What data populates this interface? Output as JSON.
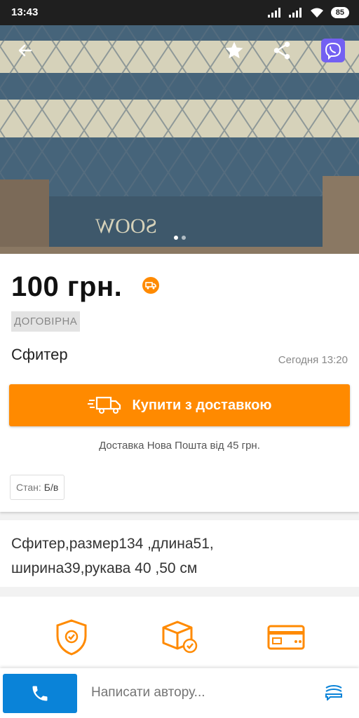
{
  "status_bar": {
    "time": "13:43",
    "battery": "85"
  },
  "toolbar": {
    "icons": [
      "back-arrow-icon",
      "star-icon",
      "share-icon",
      "viber-icon"
    ]
  },
  "gallery": {
    "image_text": "SOOW",
    "dots": 2,
    "active_dot": 0
  },
  "listing": {
    "price": "100 грн.",
    "negotiable": "ДОГОВІРНА",
    "title": "Сфитер",
    "date": "Сегодня 13:20",
    "buy_label": "Купити з доставкою",
    "delivery_note": "Доставка Нова Пошта від 45 грн.",
    "condition_label": "Стан:",
    "condition_value": "Б/в"
  },
  "description": {
    "line1": "Сфитер,размер134 ,длина51,",
    "line2": "ширина39,рукава 40 ,50 см"
  },
  "features": [
    {
      "icon": "shield-check-icon"
    },
    {
      "icon": "box-check-icon"
    },
    {
      "icon": "card-icon"
    }
  ],
  "bottom_bar": {
    "message_placeholder": "Написати автору..."
  },
  "colors": {
    "accent": "#ff8a00",
    "call_button": "#0a83d8",
    "viber": "#7360f2"
  }
}
